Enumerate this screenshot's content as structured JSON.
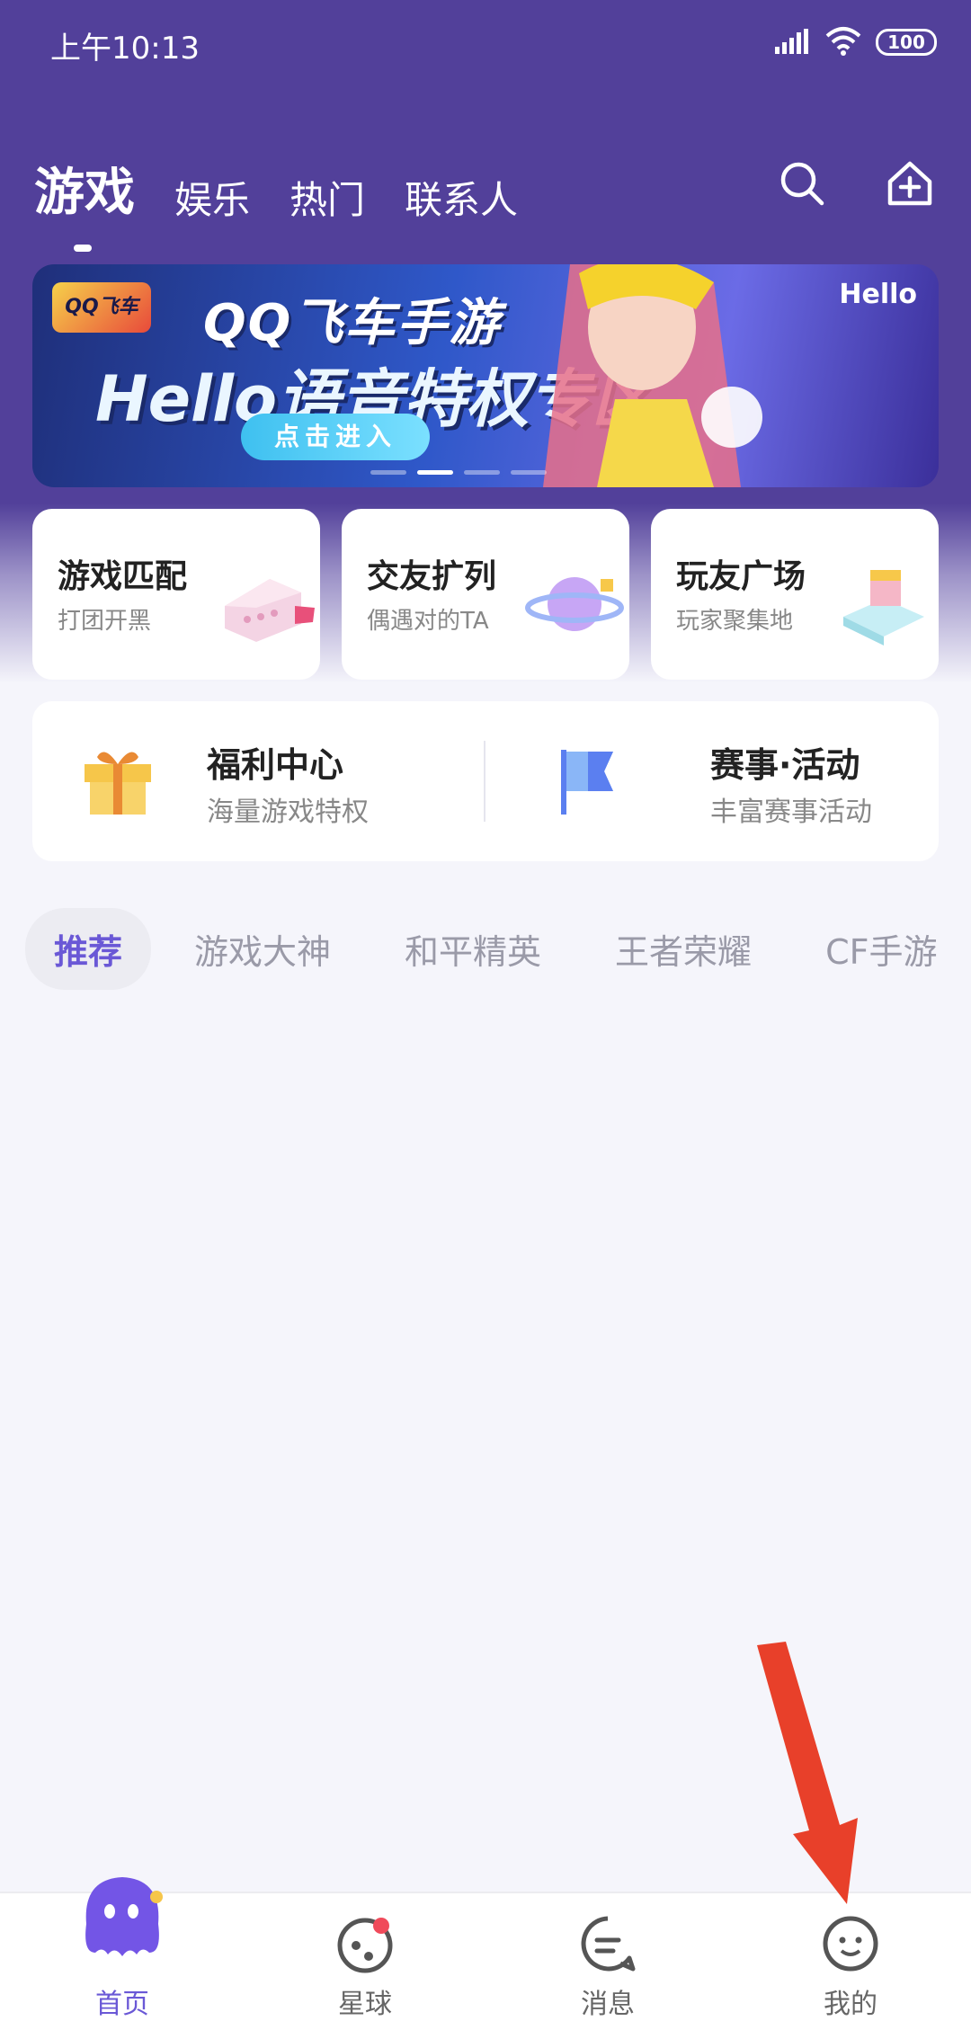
{
  "status": {
    "time": "上午10:13",
    "battery": "100"
  },
  "header": {
    "tabs": [
      {
        "label": "游戏",
        "active": true
      },
      {
        "label": "娱乐"
      },
      {
        "label": "热门"
      },
      {
        "label": "联系人"
      }
    ],
    "icons": [
      "search-icon",
      "add-house-icon"
    ]
  },
  "banner": {
    "logo": "QQ飞车",
    "title": "QQ飞车手游",
    "subtitle": "Hello语音特权专区",
    "button": "点击进入",
    "brand": "Hello",
    "page_count": 4,
    "current_page": 2
  },
  "cards": [
    {
      "title": "游戏匹配",
      "subtitle": "打团开黑",
      "icon": "ship-icon"
    },
    {
      "title": "交友扩列",
      "subtitle": "偶遇对的TA",
      "icon": "planet-icon"
    },
    {
      "title": "玩友广场",
      "subtitle": "玩家聚集地",
      "icon": "plaza-icon"
    }
  ],
  "panel": [
    {
      "title": "福利中心",
      "subtitle": "海量游戏特权",
      "icon": "gift-icon"
    },
    {
      "title": "赛事·活动",
      "subtitle": "丰富赛事活动",
      "icon": "flag-icon"
    }
  ],
  "chips": [
    {
      "label": "推荐",
      "active": true
    },
    {
      "label": "游戏大神"
    },
    {
      "label": "和平精英"
    },
    {
      "label": "王者荣耀"
    },
    {
      "label": "CF手游"
    }
  ],
  "bottom_nav": [
    {
      "label": "首页",
      "active": true,
      "icon": "home-mascot-icon"
    },
    {
      "label": "星球",
      "icon": "planet-nav-icon"
    },
    {
      "label": "消息",
      "icon": "message-icon"
    },
    {
      "label": "我的",
      "icon": "profile-icon"
    }
  ],
  "colors": {
    "header": "#52409a",
    "accent": "#6a58d6",
    "annotation_arrow": "#e8402a"
  }
}
